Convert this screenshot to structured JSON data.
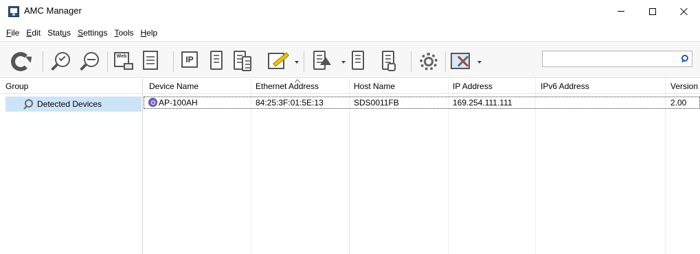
{
  "window": {
    "title": "AMC Manager",
    "icon": "app-icon",
    "controls": [
      "minimize-icon",
      "maximize-icon",
      "close-icon"
    ]
  },
  "menu": [
    {
      "label": "File",
      "underline": "F",
      "rest": "ile"
    },
    {
      "label": "Edit",
      "underline": "E",
      "rest": "dit"
    },
    {
      "label": "Status",
      "pre": "Stat",
      "underline": "u",
      "rest": "s"
    },
    {
      "label": "Settings",
      "underline": "S",
      "rest": "ettings"
    },
    {
      "label": "Tools",
      "underline": "T",
      "rest": "ools"
    },
    {
      "label": "Help",
      "underline": "H",
      "rest": "elp"
    }
  ],
  "toolbar": {
    "icons": [
      "refresh-icon",
      "search-check-icon",
      "search-minus-icon",
      "web-icon",
      "document-icon",
      "ip-icon",
      "server-wrench-icon",
      "servers-wrench-icon",
      "edit-icon",
      "upload-icon",
      "download-icon",
      "power-icon",
      "gear-icon",
      "tools-icon"
    ],
    "ip_label": "IP",
    "web_label": "Web",
    "search": {
      "value": "",
      "placeholder": ""
    }
  },
  "group_pane": {
    "header": "Group",
    "items": [
      {
        "label": "Detected Devices",
        "icon": "search-icon",
        "selected": true
      }
    ]
  },
  "device_list": {
    "columns": [
      "Device Name",
      "Ethernet Address",
      "Host Name",
      "IP Address",
      "IPv6 Address",
      "Version"
    ],
    "sorted_column": "Ethernet Address",
    "rows": [
      {
        "device_name": "AP-100AH",
        "ethernet_address": "84:25:3F:01:5E:13",
        "host_name": "SDS0011FB",
        "ip_address": "169.254.111.111",
        "ipv6_address": "",
        "version": "2.00"
      }
    ]
  },
  "colors": {
    "selection": "#cce4f7",
    "toolbar_bg": "#f7f7f7",
    "device_icon": "#7a64c6",
    "search_icon": "#1a5fb4"
  }
}
